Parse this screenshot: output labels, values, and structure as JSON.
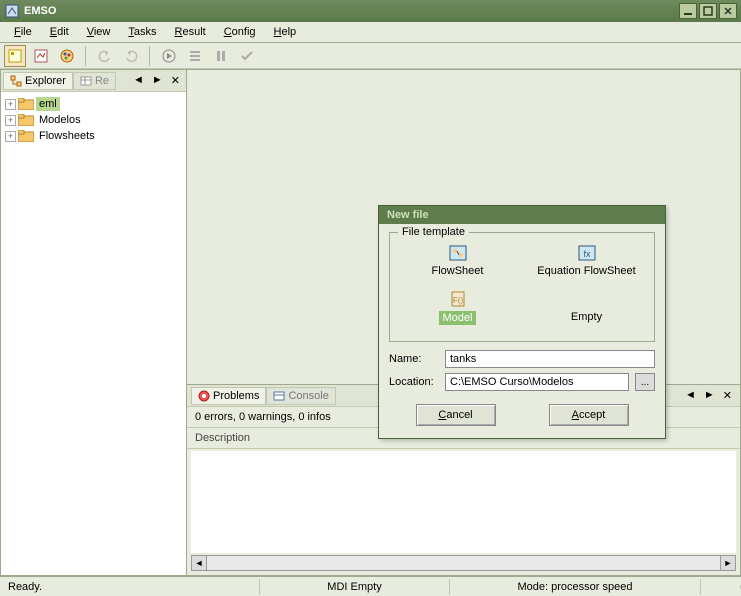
{
  "title": "EMSO",
  "menu": {
    "file": "File",
    "edit": "Edit",
    "view": "View",
    "tasks": "Tasks",
    "result": "Result",
    "config": "Config",
    "help": "Help"
  },
  "sidebar": {
    "tabs": {
      "explorer": "Explorer",
      "results": "Re"
    },
    "tree": [
      {
        "label": "eml",
        "selected": true
      },
      {
        "label": "Modelos",
        "selected": false
      },
      {
        "label": "Flowsheets",
        "selected": false
      }
    ]
  },
  "bottom": {
    "tabs": {
      "problems": "Problems",
      "console": "Console"
    },
    "status_line": "0 errors, 0 warnings, 0 infos",
    "desc_header": "Description"
  },
  "statusbar": {
    "ready": "Ready.",
    "mdi": "MDI Empty",
    "mode": "Mode: processor speed"
  },
  "dialog": {
    "title": "New file",
    "legend": "File template",
    "templates": {
      "flowsheet": "FlowSheet",
      "equation_flowsheet": "Equation FlowSheet",
      "model": "Model",
      "empty": "Empty"
    },
    "name_label": "Name:",
    "name_value": "tanks",
    "location_label": "Location:",
    "location_value": "C:\\EMSO Curso\\Modelos",
    "cancel": "Cancel",
    "accept": "Accept"
  }
}
